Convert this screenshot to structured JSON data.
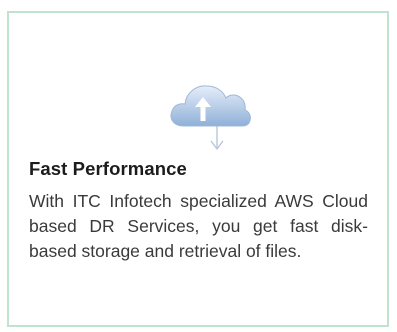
{
  "feature": {
    "icon": "cloud-upload-download-icon",
    "title": "Fast Performance",
    "description": "With ITC Infotech specialized AWS Cloud based DR Services, you get fast disk-based storage and retrieval of files."
  },
  "colors": {
    "border": "#bfe3cf",
    "cloud_light": "#dbe6f5",
    "cloud_dark": "#7e9fc9",
    "arrow": "#ffffff",
    "title": "#1c1c1c",
    "text": "#3a3a3a"
  }
}
